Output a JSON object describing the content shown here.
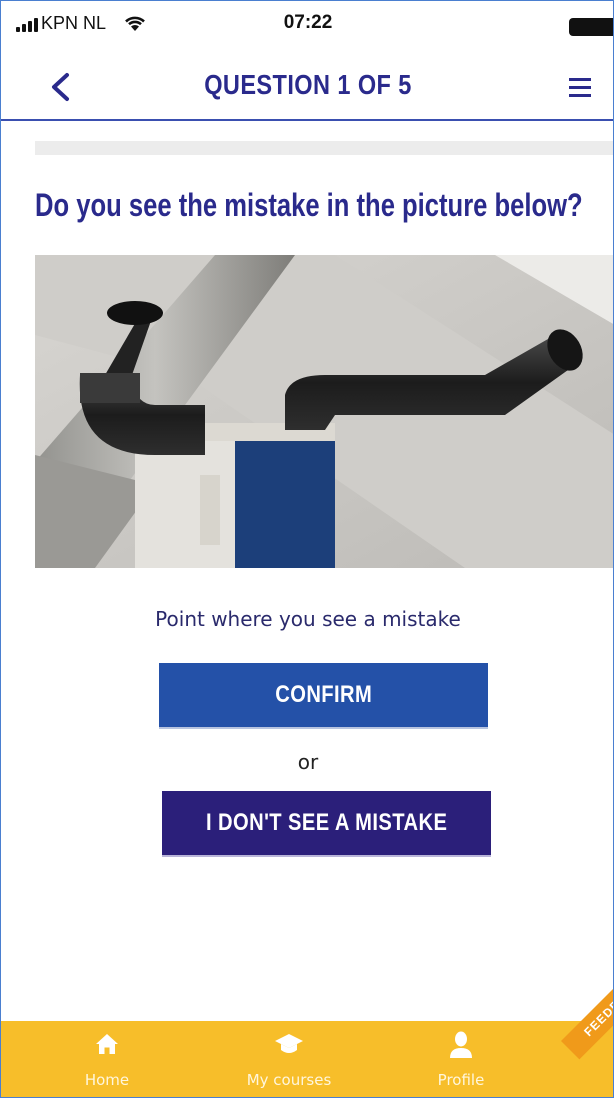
{
  "status_bar": {
    "carrier": "KPN NL",
    "time": "07:22",
    "icons": [
      "signal-icon",
      "wifi-icon",
      "battery-icon"
    ]
  },
  "nav": {
    "title": "QUESTION 1 OF 5",
    "back_icon": "chevron-left-icon",
    "menu_icon": "hamburger-menu-icon"
  },
  "progress": {
    "current": 1,
    "total": 5,
    "fraction": 0.0
  },
  "question": {
    "text": "Do you see the mistake in the picture below?"
  },
  "photo": {
    "subject": "ventilation-unit-photo"
  },
  "actions": {
    "instruction": "Point where you see a mistake",
    "confirm_label": "CONFIRM",
    "or_label": "or",
    "no_mistake_label": "I DON'T SEE A MISTAKE"
  },
  "tab_bar": {
    "items": [
      {
        "label": "Home",
        "icon": "home-icon"
      },
      {
        "label": "My courses",
        "icon": "graduation-cap-icon"
      },
      {
        "label": "Profile",
        "icon": "user-icon"
      }
    ],
    "feedback_label": "FEEDBACK"
  },
  "colors": {
    "primary": "#2a2a8c",
    "confirm": "#2451a8",
    "no_mistake": "#2b1f7a",
    "tab_bar": "#f7be2a",
    "feedback": "#f09a1a"
  }
}
